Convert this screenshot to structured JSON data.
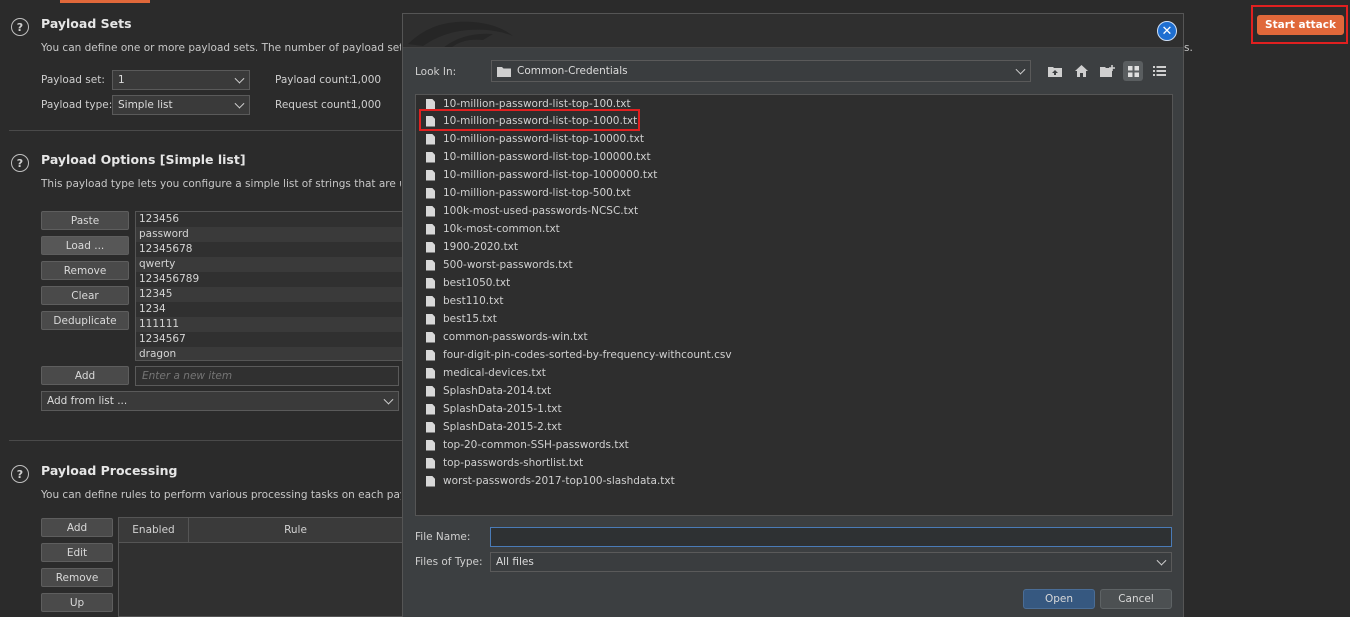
{
  "payload_sets": {
    "title": "Payload Sets",
    "description": "You can define one or more payload sets. The number of payload sets depends on the attack type defined in the Positions tab. Various payload types are available for each payload set, and each payload type can be customized in different ways.",
    "desc_tail": "s.",
    "set_label": "Payload set:",
    "set_value": "1",
    "type_label": "Payload type:",
    "type_value": "Simple list",
    "count_label": "Payload count:",
    "count_value": "1,000",
    "request_label": "Request count:",
    "request_value": "1,000"
  },
  "start_attack": "Start attack",
  "payload_options": {
    "title": "Payload Options [Simple list]",
    "description": "This payload type lets you configure a simple list of strings that are used as payloads.",
    "buttons": [
      "Paste",
      "Load ...",
      "Remove",
      "Clear",
      "Deduplicate"
    ],
    "items": [
      "123456",
      "password",
      "12345678",
      "qwerty",
      "123456789",
      "12345",
      "1234",
      "111111",
      "1234567",
      "dragon"
    ],
    "add_button": "Add",
    "add_placeholder": "Enter a new item",
    "add_from_list": "Add from list ..."
  },
  "payload_processing": {
    "title": "Payload Processing",
    "description": "You can define rules to perform various processing tasks on each payload before it is used.",
    "buttons": [
      "Add",
      "Edit",
      "Remove",
      "Up"
    ],
    "col_enabled": "Enabled",
    "col_rule": "Rule"
  },
  "dialog": {
    "look_in_label": "Look In:",
    "look_in_value": "Common-Credentials",
    "files": [
      "10-million-password-list-top-100.txt",
      "10-million-password-list-top-1000.txt",
      "10-million-password-list-top-10000.txt",
      "10-million-password-list-top-100000.txt",
      "10-million-password-list-top-1000000.txt",
      "10-million-password-list-top-500.txt",
      "100k-most-used-passwords-NCSC.txt",
      "10k-most-common.txt",
      "1900-2020.txt",
      "500-worst-passwords.txt",
      "best1050.txt",
      "best110.txt",
      "best15.txt",
      "common-passwords-win.txt",
      "four-digit-pin-codes-sorted-by-frequency-withcount.csv",
      "medical-devices.txt",
      "SplashData-2014.txt",
      "SplashData-2015-1.txt",
      "SplashData-2015-2.txt",
      "top-20-common-SSH-passwords.txt",
      "top-passwords-shortlist.txt",
      "worst-passwords-2017-top100-slashdata.txt"
    ],
    "file_name_label": "File Name:",
    "file_name_value": "",
    "files_of_type_label": "Files of Type:",
    "files_of_type_value": "All files",
    "open_button": "Open",
    "cancel_button": "Cancel"
  },
  "colors": {
    "accent": "#e0683a",
    "highlight": "#e02020",
    "dialog_primary": "#365880"
  },
  "icons": [
    "help-icon",
    "close-icon",
    "folder-icon",
    "up-folder-icon",
    "home-icon",
    "new-folder-icon",
    "list-view-icon",
    "details-view-icon",
    "file-icon",
    "chevron-down-icon"
  ]
}
